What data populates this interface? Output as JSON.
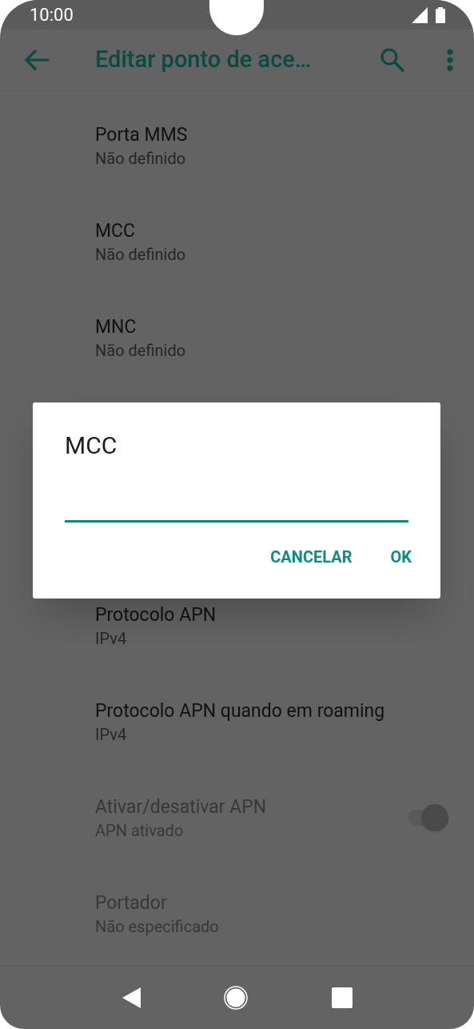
{
  "status_bar": {
    "time": "10:00"
  },
  "toolbar": {
    "title": "Editar ponto de ace…"
  },
  "items_above": [
    {
      "kind": "text",
      "title": "Porta MMS",
      "summary": "Não definido",
      "disabled": false
    },
    {
      "kind": "text",
      "title": "MCC",
      "summary": "Não definido",
      "disabled": false
    },
    {
      "kind": "text",
      "title": "MNC",
      "summary": "Não definido",
      "disabled": false
    }
  ],
  "items_below": [
    {
      "kind": "text",
      "title": "Protocolo APN",
      "summary": "IPv4",
      "disabled": false
    },
    {
      "kind": "text",
      "title": "Protocolo APN quando em roaming",
      "summary": "IPv4",
      "disabled": false
    },
    {
      "kind": "switch",
      "title": "Ativar/desativar APN",
      "summary": "APN ativado",
      "disabled": true,
      "on": true
    },
    {
      "kind": "text",
      "title": "Portador",
      "summary": "Não especificado",
      "disabled": true
    }
  ],
  "dialog": {
    "title": "MCC",
    "buttons": [
      "CANCELAR",
      "OK"
    ]
  }
}
